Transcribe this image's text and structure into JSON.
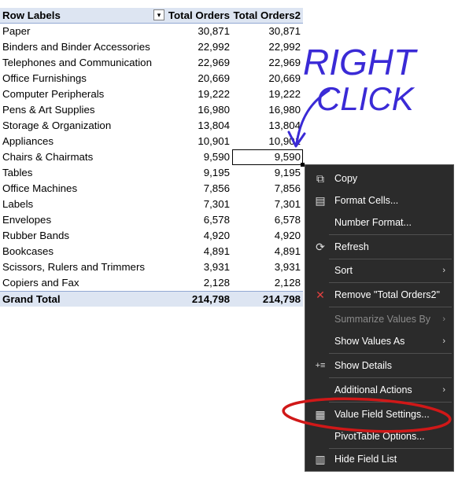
{
  "pivot": {
    "header": {
      "row_labels": "Row Labels",
      "col1": "Total Orders",
      "col2": "Total Orders2",
      "filter_icon": "filter-dropdown-icon",
      "filter_glyph": "▾"
    },
    "rows": [
      {
        "label": "Paper",
        "v1": "30,871",
        "v2": "30,871"
      },
      {
        "label": "Binders and Binder Accessories",
        "v1": "22,992",
        "v2": "22,992"
      },
      {
        "label": "Telephones and Communication",
        "v1": "22,969",
        "v2": "22,969"
      },
      {
        "label": "Office Furnishings",
        "v1": "20,669",
        "v2": "20,669"
      },
      {
        "label": "Computer Peripherals",
        "v1": "19,222",
        "v2": "19,222"
      },
      {
        "label": "Pens & Art Supplies",
        "v1": "16,980",
        "v2": "16,980"
      },
      {
        "label": "Storage & Organization",
        "v1": "13,804",
        "v2": "13,804"
      },
      {
        "label": "Appliances",
        "v1": "10,901",
        "v2": "10,901"
      },
      {
        "label": "Chairs & Chairmats",
        "v1": "9,590",
        "v2": "9,590"
      },
      {
        "label": "Tables",
        "v1": "9,195",
        "v2": "9,195"
      },
      {
        "label": "Office Machines",
        "v1": "7,856",
        "v2": "7,856"
      },
      {
        "label": "Labels",
        "v1": "7,301",
        "v2": "7,301"
      },
      {
        "label": "Envelopes",
        "v1": "6,578",
        "v2": "6,578"
      },
      {
        "label": "Rubber Bands",
        "v1": "4,920",
        "v2": "4,920"
      },
      {
        "label": "Bookcases",
        "v1": "4,891",
        "v2": "4,891"
      },
      {
        "label": "Scissors, Rulers and Trimmers",
        "v1": "3,931",
        "v2": "3,931"
      },
      {
        "label": "Copiers and Fax",
        "v1": "2,128",
        "v2": "2,128"
      }
    ],
    "grand_total": {
      "label": "Grand Total",
      "v1": "214,798",
      "v2": "214,798"
    }
  },
  "context_menu": {
    "items": [
      {
        "label": "Copy",
        "icon": "copy-icon",
        "glyph": "⧉"
      },
      {
        "label": "Format Cells...",
        "icon": "format-cells-icon",
        "glyph": "▤"
      },
      {
        "label": "Number Format...",
        "icon": "",
        "glyph": ""
      },
      {
        "label": "Refresh",
        "icon": "refresh-icon",
        "glyph": "⟳"
      },
      {
        "label": "Sort",
        "icon": "",
        "glyph": "",
        "submenu": "›"
      },
      {
        "label": "Remove \"Total Orders2\"",
        "icon": "remove-x-icon",
        "glyph": "✕"
      },
      {
        "label": "Summarize Values By",
        "icon": "",
        "glyph": "",
        "submenu": "›",
        "disabled": true
      },
      {
        "label": "Show Values As",
        "icon": "",
        "glyph": "",
        "submenu": "›"
      },
      {
        "label": "Show Details",
        "icon": "show-details-icon",
        "glyph": "+≡"
      },
      {
        "label": "Additional Actions",
        "icon": "",
        "glyph": "",
        "submenu": "›"
      },
      {
        "label": "Value Field Settings...",
        "icon": "value-field-settings-icon",
        "glyph": "▦"
      },
      {
        "label": "PivotTable Options...",
        "icon": "",
        "glyph": ""
      },
      {
        "label": "Hide Field List",
        "icon": "field-list-icon",
        "glyph": "▥"
      }
    ]
  },
  "annotations": {
    "line1": "RIGHT",
    "line2": "CLICK",
    "ink_color": "#3a2ad6",
    "highlight_color": "#d01818"
  },
  "colors": {
    "header_bg": "#dde5f2",
    "menu_bg": "#2b2b2b",
    "remove_icon": "#e04040"
  }
}
